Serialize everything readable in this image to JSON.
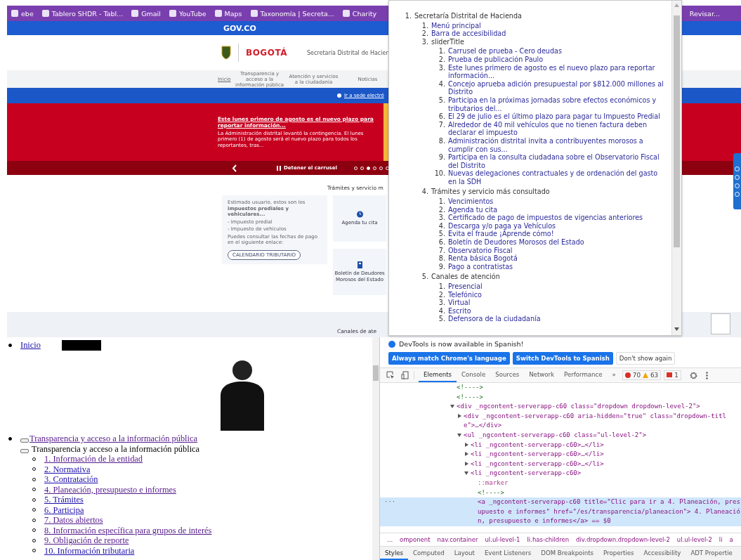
{
  "browser": {
    "bookmarks": [
      "ebe",
      "Tablero SHDR - Tabl...",
      "Gmail",
      "YouTube",
      "Maps",
      "Taxonomía | Secreta...",
      "Charity"
    ],
    "bookmark_end": "Revisar..."
  },
  "website": {
    "gov_bar": "GOV.CO",
    "logo": "BOGOTÁ",
    "entity": "Secretaría Distrital de Hacien",
    "nav": [
      {
        "label": "Inicio",
        "selected": true
      },
      {
        "label": "Transparencia y acceso a la información pública",
        "selected": false
      },
      {
        "label": "Atención y servicios a la ciudadanía",
        "selected": false
      },
      {
        "label": "Noticias",
        "selected": false
      }
    ],
    "alert_link": "Ir a sede electró",
    "banner": {
      "title": "Este lunes primero de agosto es el nuevo plazo para reportar información...",
      "body": "La Administración distrital levantó la contingencia. El lunes primero (1) de agosto será el nuevo plazo para todos los reportantes, tras..."
    },
    "carousel": {
      "pause": "Detener el carrusel",
      "dots": [
        {
          "selected": false
        },
        {
          "selected": false
        },
        {
          "selected": true
        },
        {
          "selected": false
        },
        {
          "selected": false
        },
        {
          "selected": false
        }
      ]
    },
    "services": {
      "title": "Trámites y servicio m",
      "card": {
        "intro": "Estimado usuario, estos son los **impuestos prediales y vehiculares...**",
        "bullets": [
          "- Impuesto predial",
          "- Impuesto de vehículos"
        ],
        "note": "Puedes consultar las fechas de pago en el siguiente enlace:",
        "button": "CALENDARIO TRIBUTARIO"
      },
      "tiles": [
        {
          "kind": "clock",
          "label": "Agenda tu cita"
        },
        {
          "kind": "building",
          "label": "Boletín de Deudores Morosos del Estado"
        }
      ]
    },
    "channels_title": "Canales de ate"
  },
  "popup": {
    "items": [
      {
        "num": "1.",
        "label": "Secretaría Distrital de Hacienda",
        "children": [
          {
            "num": "1.",
            "label": "Menú principal"
          },
          {
            "num": "2.",
            "label": "Barra de accesibilidad"
          },
          {
            "num": "3.",
            "label": "sliderTitle",
            "children": [
              {
                "num": "1.",
                "label": "Carrusel de prueba - Cero deudas"
              },
              {
                "num": "2.",
                "label": "Prueba de publicación Paulo"
              },
              {
                "num": "3.",
                "label": "Este lunes primero de agosto es el nuevo plazo para reportar información..."
              },
              {
                "num": "4.",
                "label": "Concejo aprueba adición presupuestal por $812.000 millones al Distrito"
              },
              {
                "num": "5.",
                "label": "Participa en la próximas jornadas sobre efectos económicos y tributarios del..."
              },
              {
                "num": "6.",
                "label": "El 29 de julio es el último plazo para pagar tu Impuesto Predial"
              },
              {
                "num": "7.",
                "label": "Alrededor de 40 mil vehículos que no tienen factura deben declarar el impuesto"
              },
              {
                "num": "8.",
                "label": "Administración distrital invita a contribuyentes morosos a cumplir con sus..."
              },
              {
                "num": "9.",
                "label": "Participa en la consulta ciudadana sobre el Observatorio Fiscal del Distrito"
              },
              {
                "num": "10.",
                "label": "Nuevas delegaciones contractuales y de ordenación del gasto en la SDH"
              }
            ]
          },
          {
            "num": "4.",
            "label": "Trámites y servicio más consultado",
            "children": [
              {
                "num": "1.",
                "label": "Vencimientos"
              },
              {
                "num": "2.",
                "label": "Agenda tu cita"
              },
              {
                "num": "3.",
                "label": "Certificado de pago de impuestos de vigencias anteriores"
              },
              {
                "num": "4.",
                "label": "Descarga y/o paga ya Vehículos"
              },
              {
                "num": "5.",
                "label": "Evita el fraude ¡Aprende cómo!"
              },
              {
                "num": "6.",
                "label": "Boletín de Deudores Morosos del Estado"
              },
              {
                "num": "7.",
                "label": "Observatorio Fiscal"
              },
              {
                "num": "8.",
                "label": "Renta básica Bogotá"
              },
              {
                "num": "9.",
                "label": "Pago a contratistas"
              }
            ]
          },
          {
            "num": "5.",
            "label": "Canales de atención",
            "children": [
              {
                "num": "1.",
                "label": "Presencial"
              },
              {
                "num": "2.",
                "label": "Telefónico"
              },
              {
                "num": "3.",
                "label": "Virtual"
              },
              {
                "num": "4.",
                "label": "Escrito"
              },
              {
                "num": "5.",
                "label": "Defensora de la ciudadanía"
              }
            ]
          }
        ]
      }
    ]
  },
  "page": {
    "home": "Inicio",
    "section_link": "Transparencia y acceso a la información pública",
    "expanded": true,
    "section_title": "Transparencia y acceso a la información pública",
    "items": [
      {
        "label": "1. Información de la entidad",
        "visited": true
      },
      {
        "label": "2. Normativa",
        "visited": false
      },
      {
        "label": "3. Contratación",
        "visited": false
      },
      {
        "label": "4. Planeación, presupuesto e informes",
        "visited": true
      },
      {
        "label": "5. Trámites",
        "visited": false
      },
      {
        "label": "6. Participa",
        "visited": false
      },
      {
        "label": "7. Datos abiertos",
        "visited": true
      },
      {
        "label": "8. Información específica para grupos de interés",
        "visited": true
      },
      {
        "label": "9. Obligación de reporte",
        "visited": true
      },
      {
        "label": "10. Información tributaria",
        "visited": false
      }
    ]
  },
  "devtools": {
    "notice": "DevTools is now available in Spanish!",
    "buttons": [
      {
        "label": "Always match Chrome's language",
        "kind": "primary"
      },
      {
        "label": "Switch DevTools to Spanish",
        "kind": "primary"
      },
      {
        "label": "Don't show again",
        "kind": "plain"
      }
    ],
    "tabs": [
      {
        "label": "Elements",
        "selected": true
      },
      {
        "label": "Console",
        "selected": false
      },
      {
        "label": "Sources",
        "selected": false
      },
      {
        "label": "Network",
        "selected": false
      },
      {
        "label": "Performance",
        "selected": false
      }
    ],
    "more": "»",
    "errors": "70",
    "warnings": "63",
    "issues": "1",
    "dom": [
      {
        "kind": "comment",
        "text": "<!---->",
        "selected": false
      },
      {
        "kind": "comment",
        "text": "<!---->",
        "selected": false
      },
      {
        "kind": "element",
        "text": "<div _ngcontent-serverapp-c60 class=\"dropdown dropdown-level-2\">",
        "expanded": true,
        "selected": false,
        "children": [
          {
            "kind": "element",
            "text": "<div _ngcontent-serverapp-c60 aria-hidden=\"true\" class=\"dropdown-title\">…</div>",
            "expanded": false,
            "selected": false
          },
          {
            "kind": "element",
            "text": "<ul _ngcontent-serverapp-c60 class=\"ul-level-2\">",
            "expanded": true,
            "selected": false,
            "children": [
              {
                "kind": "element",
                "text": "<li _ngcontent-serverapp-c60>…</li>",
                "expanded": false,
                "selected": false
              },
              {
                "kind": "element",
                "text": "<li _ngcontent-serverapp-c60>…</li>",
                "expanded": false,
                "selected": false
              },
              {
                "kind": "element",
                "text": "<li _ngcontent-serverapp-c60>…</li>",
                "expanded": false,
                "selected": false
              },
              {
                "kind": "element",
                "text": "<li _ngcontent-serverapp-c60>",
                "expanded": true,
                "selected": false,
                "children": [
                  {
                    "kind": "pseudo",
                    "text": "::marker",
                    "selected": false
                  },
                  {
                    "kind": "comment",
                    "text": "<!---->",
                    "selected": false
                  },
                  {
                    "kind": "element",
                    "text": "<a _ngcontent-serverapp-c60 title=\"Clic para ir a 4. Planeación, presupuesto e informes\" href=\"/es/transparencia/planeacion\"> 4. Planeación, presupuesto e informes</a> == $0",
                    "selected": true,
                    "gutter": "···"
                  }
                ]
              }
            ]
          }
        ]
      }
    ],
    "breadcrumb": [
      "...",
      "omponent",
      "nav.container",
      "ul.ul-level-1",
      "li.has-children",
      "div.dropdown.dropdown-level-2",
      "ul.ul-level-2",
      "li",
      "a"
    ],
    "panel_tabs": [
      {
        "label": "Styles",
        "selected": true
      },
      {
        "label": "Computed",
        "selected": false
      },
      {
        "label": "Layout",
        "selected": false
      },
      {
        "label": "Event Listeners",
        "selected": false
      },
      {
        "label": "DOM Breakpoints",
        "selected": false
      },
      {
        "label": "Properties",
        "selected": false
      },
      {
        "label": "Accessibility",
        "selected": false
      },
      {
        "label": "ADT Propertie",
        "selected": false
      }
    ]
  }
}
